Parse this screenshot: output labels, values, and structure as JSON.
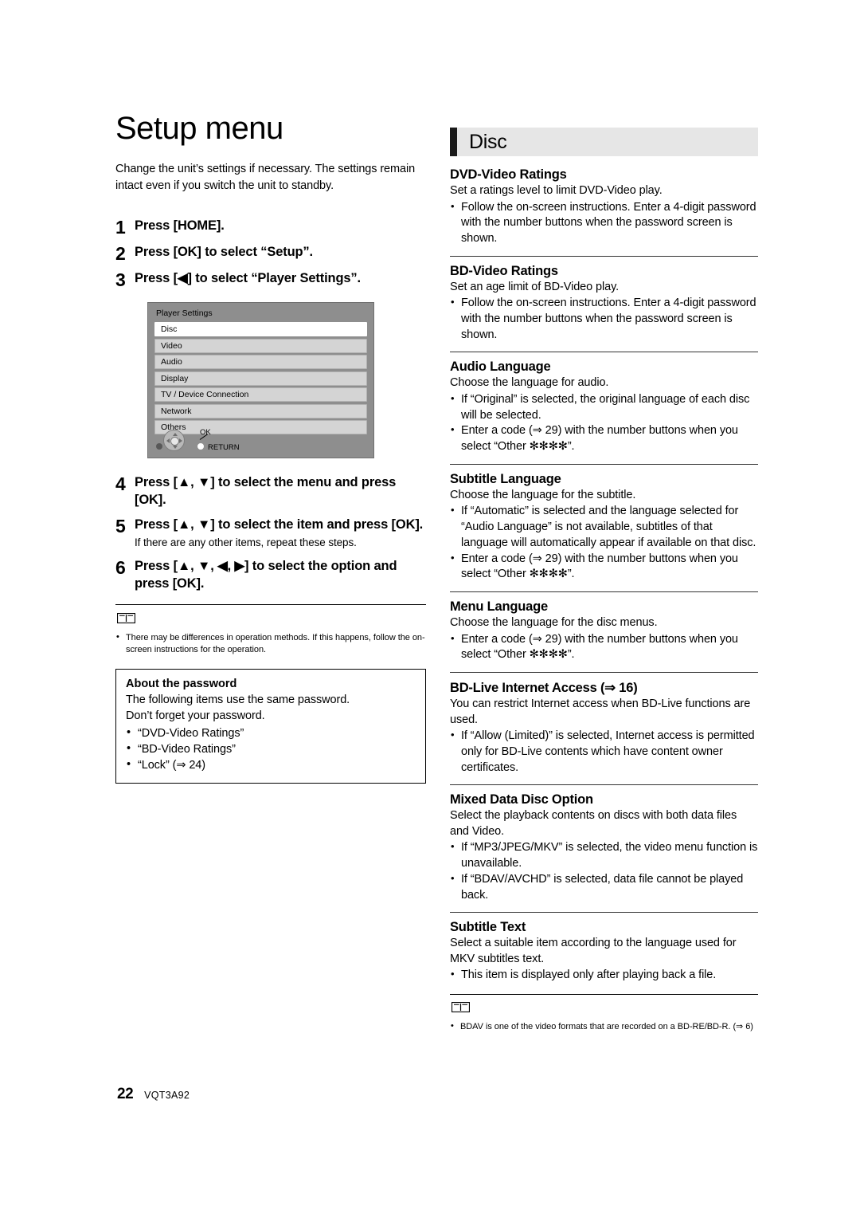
{
  "document": {
    "page_number": "22",
    "product_code": "VQT3A92"
  },
  "left": {
    "title": "Setup menu",
    "intro": "Change the unit’s settings if necessary. The settings remain intact even if you switch the unit to standby.",
    "steps": [
      {
        "num": "1",
        "text": "Press [HOME]."
      },
      {
        "num": "2",
        "text": "Press [OK] to select “Setup”."
      },
      {
        "num": "3",
        "text": "Press [◀] to select “Player Settings”."
      },
      {
        "num": "4",
        "text": "Press [▲, ▼] to select the menu and press [OK]."
      },
      {
        "num": "5",
        "text": "Press [▲, ▼] to select the item and press [OK].",
        "sub": "If there are any other items, repeat these steps."
      },
      {
        "num": "6",
        "text": "Press [▲, ▼, ◀, ▶] to select the option and press [OK]."
      }
    ],
    "menu_shot": {
      "title": "Player Settings",
      "items": [
        {
          "label": "Disc",
          "selected": true
        },
        {
          "label": "Video",
          "selected": false
        },
        {
          "label": "Audio",
          "selected": false
        },
        {
          "label": "Display",
          "selected": false
        },
        {
          "label": "TV / Device Connection",
          "selected": false
        },
        {
          "label": "Network",
          "selected": false
        },
        {
          "label": "Others",
          "selected": false
        }
      ],
      "ok_label": "OK",
      "return_label": "RETURN"
    },
    "note": {
      "bullets": [
        "There may be differences in operation methods. If this happens, follow the on-screen instructions for the operation."
      ]
    },
    "password_box": {
      "title": "About the password",
      "line1": "The following items use the same password.",
      "line2": "Don’t forget your password.",
      "items": [
        "“DVD-Video Ratings”",
        "“BD-Video Ratings”",
        "“Lock” (⇒ 24)"
      ]
    }
  },
  "right": {
    "section_title": "Disc",
    "items": [
      {
        "heading": "DVD-Video Ratings",
        "desc": "Set a ratings level to limit DVD-Video play.",
        "bullets": [
          "Follow the on-screen instructions. Enter a 4-digit password with the number buttons when the password screen is shown."
        ]
      },
      {
        "heading": "BD-Video Ratings",
        "desc": "Set an age limit of BD-Video play.",
        "bullets": [
          "Follow the on-screen instructions. Enter a 4-digit password with the number buttons when the password screen is shown."
        ]
      },
      {
        "heading": "Audio Language",
        "desc": "Choose the language for audio.",
        "bullets": [
          "If “Original” is selected, the original language of each disc will be selected.",
          "Enter a code (⇒ 29) with the number buttons when you select “Other ✻✻✻✻”."
        ]
      },
      {
        "heading": "Subtitle Language",
        "desc": "Choose the language for the subtitle.",
        "bullets": [
          "If “Automatic” is selected and the language selected for “Audio Language” is not available, subtitles of that language will automatically appear if available on that disc.",
          "Enter a code (⇒ 29) with the number buttons when you select “Other ✻✻✻✻”."
        ]
      },
      {
        "heading": "Menu Language",
        "desc": "Choose the language for the disc menus.",
        "bullets": [
          "Enter a code (⇒ 29) with the number buttons when you select “Other ✻✻✻✻”."
        ]
      },
      {
        "heading": "BD-Live Internet Access (⇒ 16)",
        "desc": "You can restrict Internet access when BD-Live functions are used.",
        "bullets": [
          "If “Allow (Limited)” is selected, Internet access is permitted only for BD-Live contents which have content owner certificates."
        ]
      },
      {
        "heading": "Mixed Data Disc Option",
        "desc": "Select the playback contents on discs with both data files and Video.",
        "bullets": [
          "If “MP3/JPEG/MKV” is selected, the video menu function is unavailable.",
          "If “BDAV/AVCHD” is selected, data file cannot be played back."
        ]
      },
      {
        "heading": "Subtitle Text",
        "desc": "Select a suitable item according to the language used for MKV subtitles text.",
        "bullets": [
          "This item is displayed only after playing back a file."
        ]
      }
    ],
    "note": {
      "bullets": [
        "BDAV is one of the video formats that are recorded on a BD-RE/BD-R. (⇒ 6)"
      ]
    }
  }
}
